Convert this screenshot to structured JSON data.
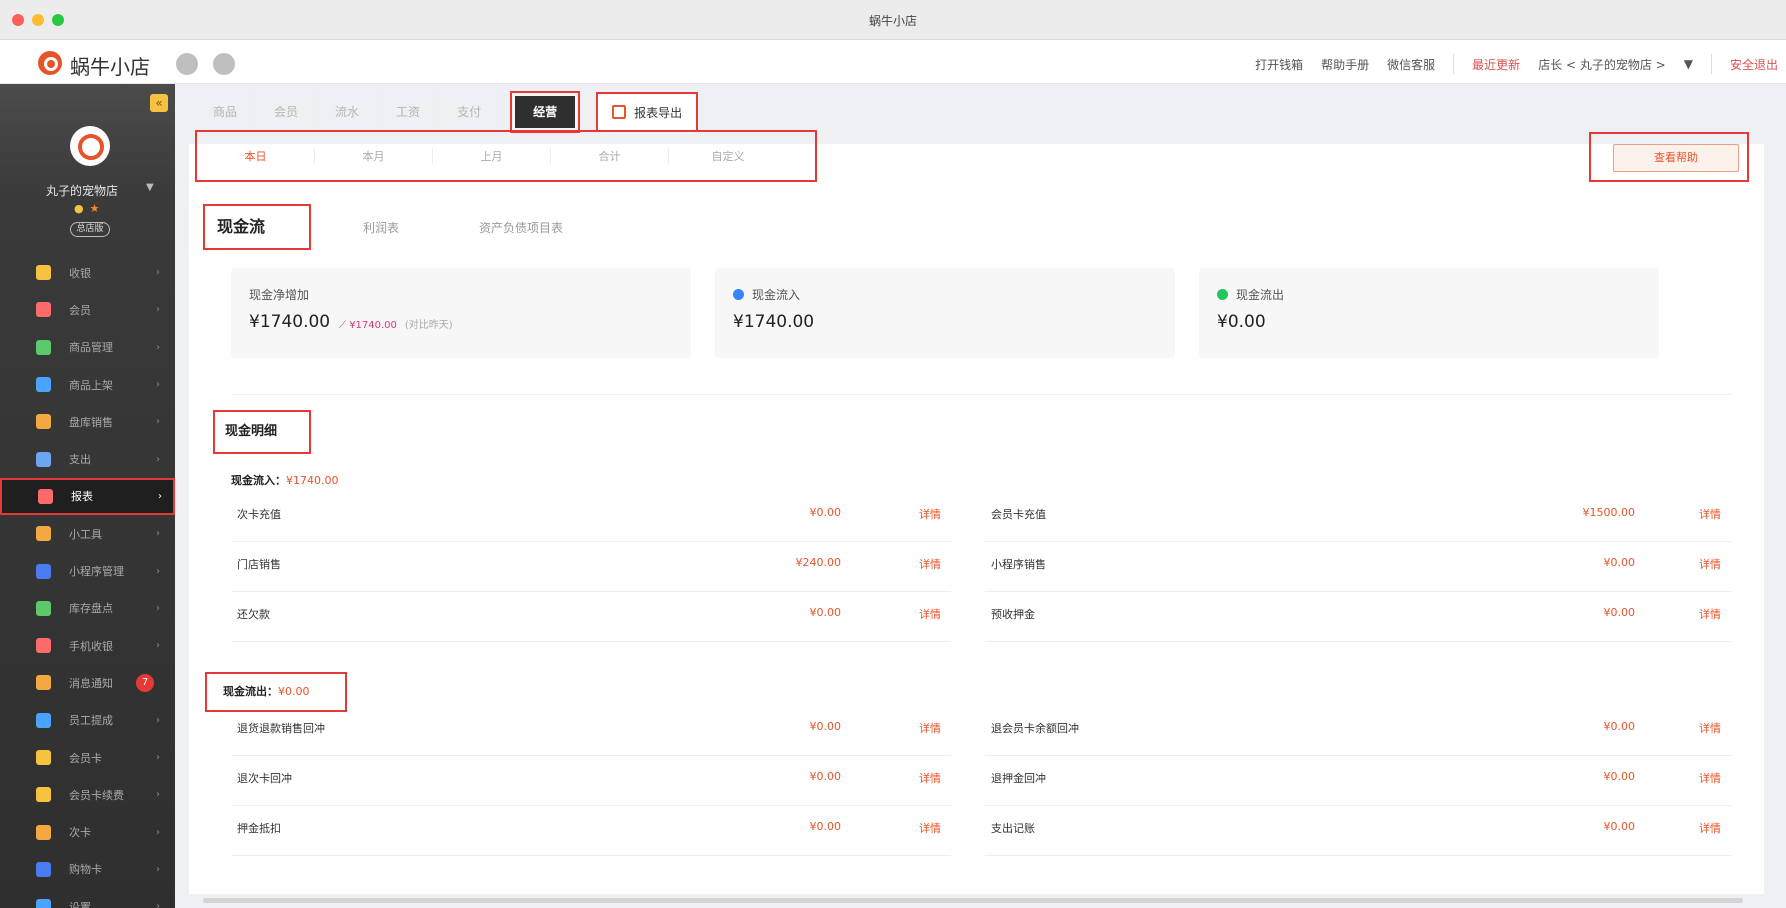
{
  "window": {
    "title": "蜗牛小店"
  },
  "appbar": {
    "name": "蜗牛小店",
    "links": [
      "打开钱箱",
      "帮助手册",
      "微信客服"
    ],
    "recent_update": "最近更新",
    "user": "店长 < 丸子的宠物店 >",
    "user_caret": "▼",
    "logout": "安全退出"
  },
  "sidebar": {
    "collapse": "«",
    "store_name": "丸子的宠物店",
    "store_caret": "▼",
    "store_tag": "总店版",
    "items": [
      {
        "label": "收银",
        "color": "#f5c242"
      },
      {
        "label": "会员",
        "color": "#ff6b6b"
      },
      {
        "label": "商品管理",
        "color": "#5cc96b"
      },
      {
        "label": "商品上架",
        "color": "#4aa3ff"
      },
      {
        "label": "盘库销售",
        "color": "#f5a742"
      },
      {
        "label": "支出",
        "color": "#6aa7f0"
      },
      {
        "label": "报表",
        "color": "#ff6b6b"
      },
      {
        "label": "小工具",
        "color": "#f5a742"
      },
      {
        "label": "小程序管理",
        "color": "#4a7cf0"
      },
      {
        "label": "库存盘点",
        "color": "#5cc96b"
      },
      {
        "label": "手机收银",
        "color": "#ff6b6b"
      },
      {
        "label": "消息通知",
        "color": "#f5a742",
        "badge": "7"
      },
      {
        "label": "员工提成",
        "color": "#4aa3ff"
      },
      {
        "label": "会员卡",
        "color": "#f5c242"
      },
      {
        "label": "会员卡续费",
        "color": "#f5c242"
      },
      {
        "label": "次卡",
        "color": "#f5a742"
      },
      {
        "label": "购物卡",
        "color": "#4a7cf0"
      },
      {
        "label": "设置",
        "color": "#4aa3ff"
      }
    ],
    "active_index": 6
  },
  "toptabs": {
    "items": [
      "商品",
      "会员",
      "流水",
      "工资",
      "支付"
    ],
    "active": "经营",
    "export": "报表导出"
  },
  "period": {
    "tabs": [
      "本日",
      "本月",
      "上月",
      "合计",
      "自定义"
    ],
    "active": "本日",
    "help": "查看帮助"
  },
  "report_tabs": {
    "active": "现金流",
    "others": [
      "利润表",
      "资产负债项目表"
    ]
  },
  "stats": {
    "net": {
      "label": "现金净增加",
      "value": "¥1740.00",
      "change": "¥1740.00",
      "compare": "(对比昨天)"
    },
    "inflow": {
      "label": "现金流入",
      "value": "¥1740.00",
      "dot": "#3b82f6"
    },
    "outflow": {
      "label": "现金流出",
      "value": "¥0.00",
      "dot": "#22c55e"
    }
  },
  "detail": {
    "title": "现金明细",
    "inflow_label": "现金流入：",
    "inflow_amount": "¥1740.00",
    "outflow_label": "现金流出：",
    "outflow_amount": "¥0.00",
    "detail_link": "详情",
    "inflow_rows": [
      {
        "left": {
          "name": "次卡充值",
          "amount": "¥0.00"
        },
        "right": {
          "name": "会员卡充值",
          "amount": "¥1500.00"
        }
      },
      {
        "left": {
          "name": "门店销售",
          "amount": "¥240.00"
        },
        "right": {
          "name": "小程序销售",
          "amount": "¥0.00"
        }
      },
      {
        "left": {
          "name": "还欠款",
          "amount": "¥0.00"
        },
        "right": {
          "name": "预收押金",
          "amount": "¥0.00"
        }
      }
    ],
    "outflow_rows": [
      {
        "left": {
          "name": "退货退款销售回冲",
          "amount": "¥0.00"
        },
        "right": {
          "name": "退会员卡余额回冲",
          "amount": "¥0.00"
        }
      },
      {
        "left": {
          "name": "退次卡回冲",
          "amount": "¥0.00"
        },
        "right": {
          "name": "退押金回冲",
          "amount": "¥0.00"
        }
      },
      {
        "left": {
          "name": "押金抵扣",
          "amount": "¥0.00"
        },
        "right": {
          "name": "支出记账",
          "amount": "¥0.00"
        }
      }
    ]
  }
}
